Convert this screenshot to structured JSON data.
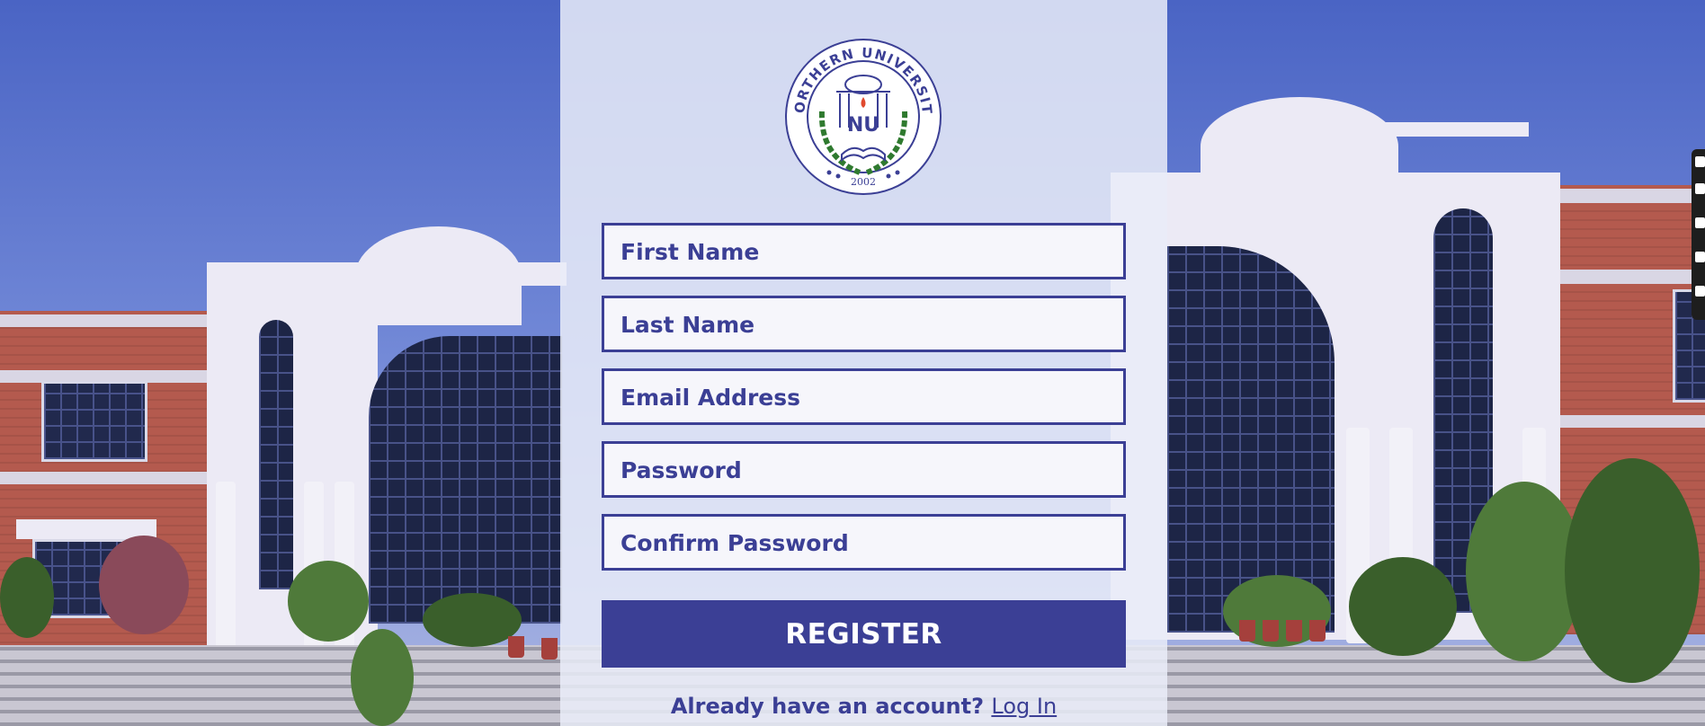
{
  "logo": {
    "ring_text": "NORTHERN UNIVERSITY",
    "monogram": "NU",
    "year": "2002"
  },
  "form": {
    "first_name_placeholder": "First Name",
    "last_name_placeholder": "Last Name",
    "email_placeholder": "Email Address",
    "password_placeholder": "Password",
    "confirm_password_placeholder": "Confirm Password",
    "register_label": "REGISTER"
  },
  "footer": {
    "already_text": "Already have an account?",
    "login_link": "Log In"
  },
  "colors": {
    "accent": "#3b3f95",
    "field_bg": "#f6f6fb",
    "panel_bg": "#e9ecf8"
  }
}
